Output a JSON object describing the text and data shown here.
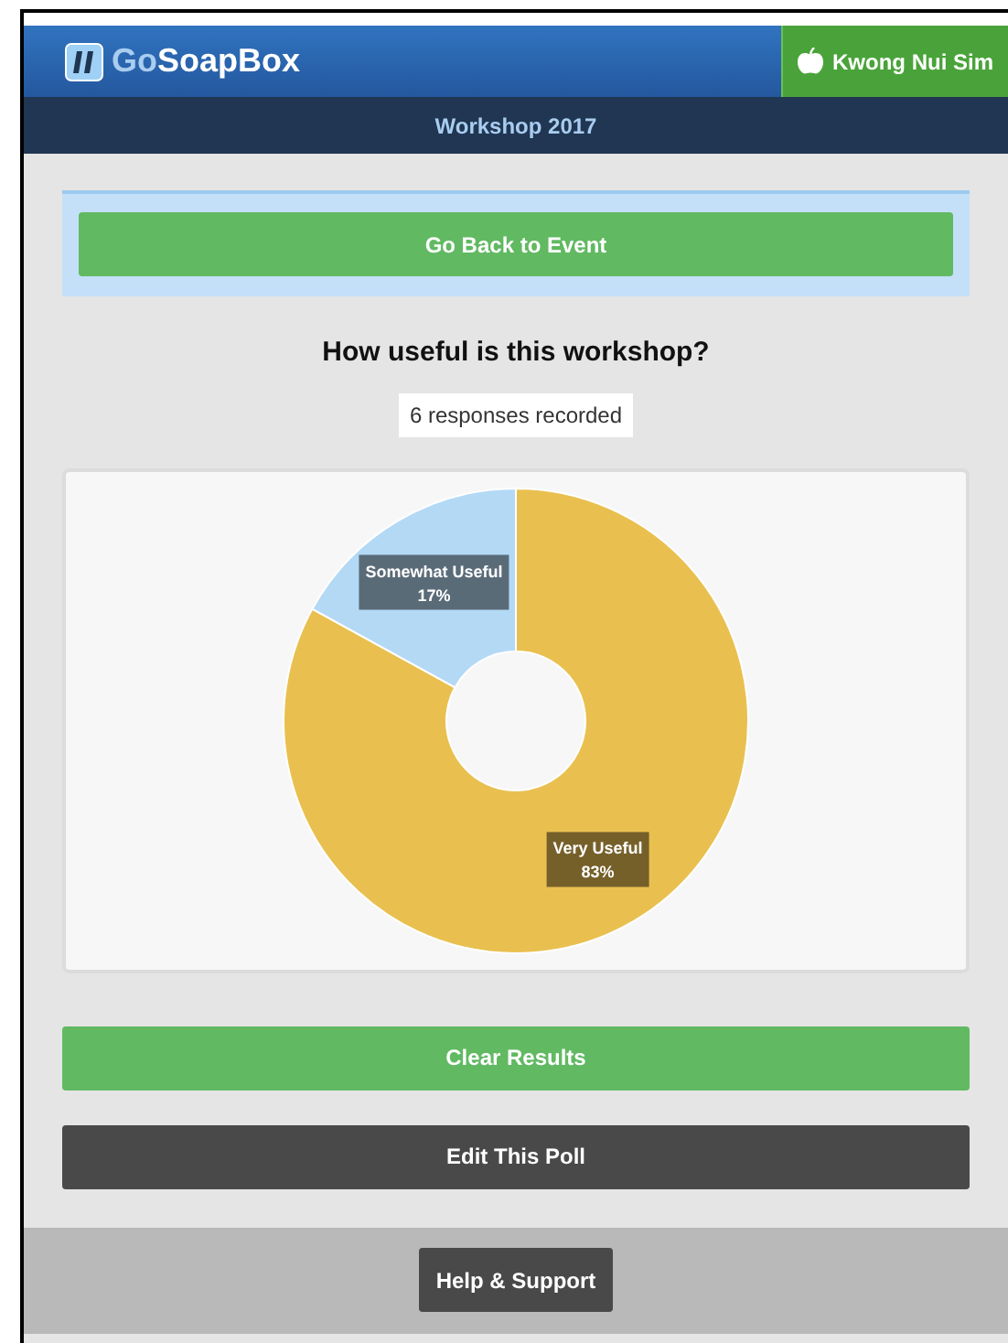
{
  "header": {
    "brand_prefix": "Go",
    "brand_name": "SoapBox",
    "user": "Kwong Nui Sim"
  },
  "event_bar": {
    "title": "Workshop 2017"
  },
  "back_button": "Go Back to Event",
  "poll": {
    "question": "How useful is this workshop?",
    "responses": "6 responses recorded",
    "chart_data": {
      "type": "donut",
      "categories": [
        "Very Useful",
        "Somewhat Useful"
      ],
      "values": [
        83,
        17
      ],
      "colors": [
        "#e9c050",
        "#b3d9f5"
      ],
      "value_labels": [
        "83%",
        "17%"
      ]
    }
  },
  "buttons": [
    {
      "label": "Clear Results",
      "kind": "success"
    },
    {
      "label": "Edit This Poll",
      "kind": "dark"
    }
  ],
  "footer": {
    "help": "Help & Support"
  }
}
